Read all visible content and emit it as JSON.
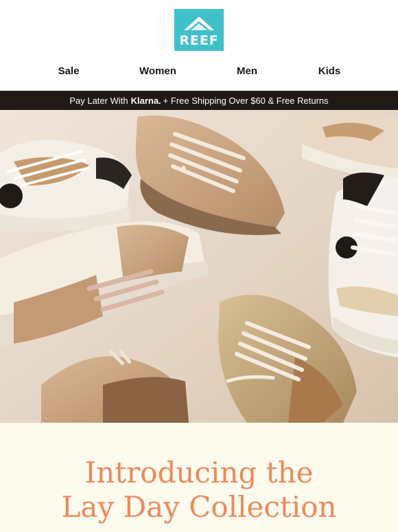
{
  "brand": {
    "logo_text": "REEF",
    "logo_color": "#3fc1c9"
  },
  "nav": {
    "items": [
      {
        "label": "Sale"
      },
      {
        "label": "Women"
      },
      {
        "label": "Men"
      },
      {
        "label": "Kids"
      }
    ]
  },
  "promo": {
    "prefix": "Pay Later With",
    "klarna": "Klarna.",
    "suffix": "+ Free Shipping Over $60 & Free Returns",
    "background": "#1f1a16"
  },
  "hero": {
    "subject": "sneakers-photo",
    "background": "#e8ddd0"
  },
  "intro": {
    "headline_line1": "Introducing the",
    "headline_line2": "Lay Day Collection",
    "headline_color": "#ee8a5a",
    "background": "#fdfaee"
  }
}
